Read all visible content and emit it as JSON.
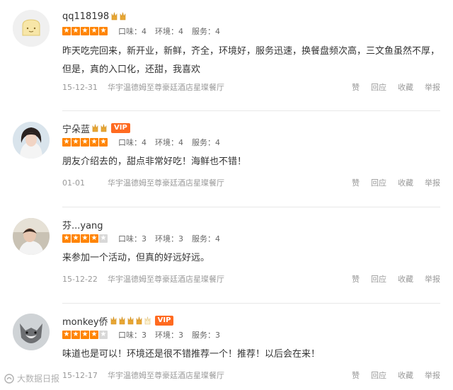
{
  "reviews": [
    {
      "username": "qq118198",
      "crowns": 2,
      "vip": "",
      "stars": 5,
      "scores": [
        "口味：4",
        "环境：4",
        "服务：4"
      ],
      "comment": "昨天吃完回来，新开业，新鲜，齐全，环境好，服务迅速，换餐盘频次高，三文鱼虽然不厚，但是，真的入口化，还甜，我喜欢",
      "date": "15-12-31",
      "shop": "华宇温德姆至尊豪廷酒店星璨餐厅",
      "actions": [
        "赞",
        "回应",
        "收藏",
        "举报"
      ]
    },
    {
      "username": "宁朵蓝",
      "crowns": 2,
      "vip": "VIP",
      "stars": 5,
      "scores": [
        "口味：4",
        "环境：4",
        "服务：4"
      ],
      "comment": "朋友介绍去的，甜点非常好吃！海鲜也不错！",
      "date": "01-01",
      "shop": "华宇温德姆至尊豪廷酒店星璨餐厅",
      "actions": [
        "赞",
        "回应",
        "收藏",
        "举报"
      ]
    },
    {
      "username": "芬...yang",
      "crowns": 0,
      "vip": "",
      "stars": 4,
      "scores": [
        "口味：3",
        "环境：3",
        "服务：4"
      ],
      "comment": "来参加一个活动，但真的好远好远。",
      "date": "15-12-22",
      "shop": "华宇温德姆至尊豪廷酒店星璨餐厅",
      "actions": [
        "赞",
        "回应",
        "收藏",
        "举报"
      ]
    },
    {
      "username": "monkey侨",
      "crowns": 5,
      "vip": "VIP",
      "stars": 4,
      "scores": [
        "口味：3",
        "环境：3",
        "服务：3"
      ],
      "comment": "味道也是可以！环境还是很不错推荐一个！推荐！以后会在来！",
      "date": "15-12-17",
      "shop": "华宇温德姆至尊豪廷酒店星璨餐厅",
      "actions": [
        "赞",
        "回应",
        "收藏",
        "举报"
      ]
    }
  ],
  "watermark": "大数据日报",
  "colors": {
    "star_on": "#ff8400",
    "vip": "#ff6a20",
    "crown": "#e8a735"
  }
}
